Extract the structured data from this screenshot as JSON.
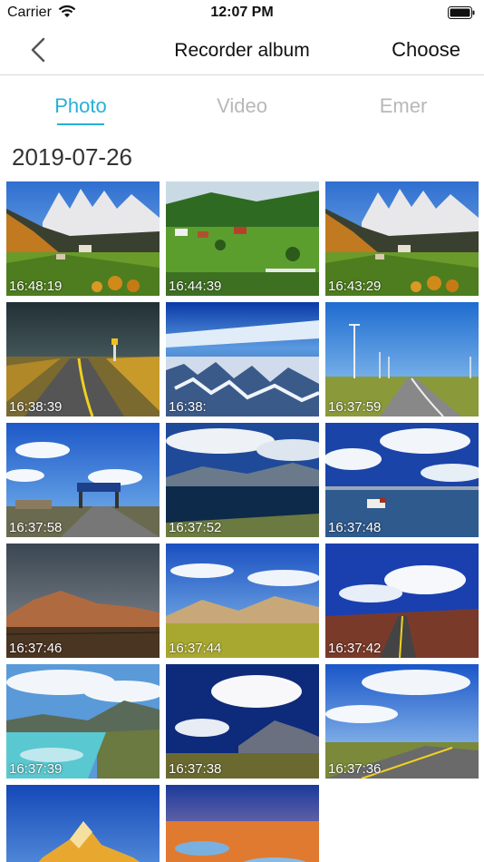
{
  "status": {
    "carrier": "Carrier",
    "time": "12:07 PM"
  },
  "nav": {
    "title": "Recorder album",
    "choose": "Choose"
  },
  "tabs": [
    {
      "label": "Photo",
      "active": true
    },
    {
      "label": "Video",
      "active": false
    },
    {
      "label": "Emer",
      "active": false
    }
  ],
  "section": {
    "date": "2019-07-26"
  },
  "photos": [
    {
      "time": "16:48:19",
      "scene": "alpine-village"
    },
    {
      "time": "16:44:39",
      "scene": "green-village"
    },
    {
      "time": "16:43:29",
      "scene": "alpine-village"
    },
    {
      "time": "16:38:39",
      "scene": "storm-road"
    },
    {
      "time": "16:38:",
      "scene": "aerial-snow"
    },
    {
      "time": "16:37:59",
      "scene": "wind-turbines"
    },
    {
      "time": "16:37:58",
      "scene": "road-gate"
    },
    {
      "time": "16:37:52",
      "scene": "lake-clouds"
    },
    {
      "time": "16:37:48",
      "scene": "lake-yak"
    },
    {
      "time": "16:37:46",
      "scene": "dark-hills"
    },
    {
      "time": "16:37:44",
      "scene": "desert-grass"
    },
    {
      "time": "16:37:42",
      "scene": "road-clouds"
    },
    {
      "time": "16:37:39",
      "scene": "turquoise-lake"
    },
    {
      "time": "16:37:38",
      "scene": "mountain-clouds"
    },
    {
      "time": "16:37:36",
      "scene": "plain-road"
    },
    {
      "time": "",
      "scene": "golden-peak"
    },
    {
      "time": "",
      "scene": "sunset-pools"
    }
  ],
  "colors": {
    "accent": "#26b0d6",
    "inactive_tab": "#b8b8b8"
  }
}
